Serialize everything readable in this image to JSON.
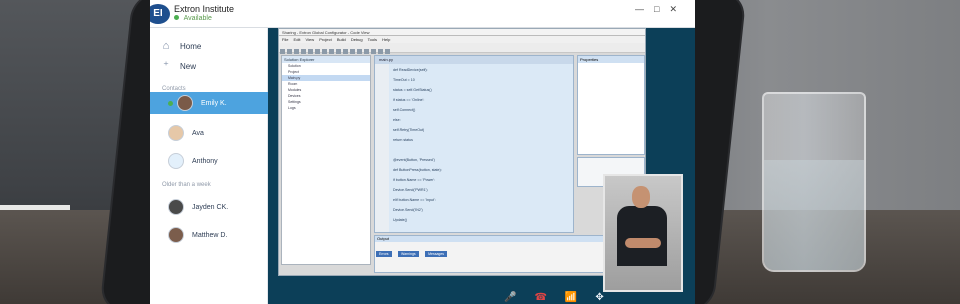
{
  "app": {
    "org_name": "Extron Institute",
    "status": "Available",
    "logo_text": "EI"
  },
  "sidebar": {
    "nav": [
      {
        "label": "Home",
        "icon": "home-icon"
      },
      {
        "label": "New",
        "icon": "add-user-icon"
      }
    ],
    "contacts_label": "Contacts",
    "contacts": [
      {
        "name": "Emily K.",
        "active": true
      },
      {
        "name": "Ava",
        "active": false
      },
      {
        "name": "Anthony",
        "active": false
      }
    ],
    "older_label": "Older than a week",
    "older": [
      {
        "name": "Jayden CK."
      },
      {
        "name": "Matthew D."
      }
    ]
  },
  "shared_screen": {
    "title": "Sharing - Extron Global Configurator - Code View",
    "menu": "File Edit View Project Build Debug Tools Help",
    "tree_title": "Solution Explorer",
    "tree_items": [
      "Solution",
      "Project",
      "Main.py",
      "Room",
      "Modules",
      "Devices",
      "Settings",
      "Logs"
    ],
    "editor_tab": "main.py",
    "code_lines": [
      "def ReadDevice(self):",
      "    TimeOut = 10",
      "    status = self.GetStatus()",
      "    if status == 'Online':",
      "        self.Connect()",
      "    else:",
      "        self.Retry(TimeOut)",
      "    return status",
      "",
      "@event(Button, 'Pressed')",
      "def ButtonPress(button, state):",
      "    if button.Name == 'Power':",
      "        Device.Send('PWR1')",
      "    elif button.Name == 'Input':",
      "        Device.Send('IN2')",
      "    Update()"
    ],
    "right_panel_title": "Properties",
    "output_title": "Output",
    "output_tabs": [
      "Errors",
      "Warnings",
      "Messages"
    ]
  },
  "call_controls": {
    "items": [
      "mute-icon",
      "hangup-icon",
      "signal-icon",
      "settings-icon"
    ]
  }
}
